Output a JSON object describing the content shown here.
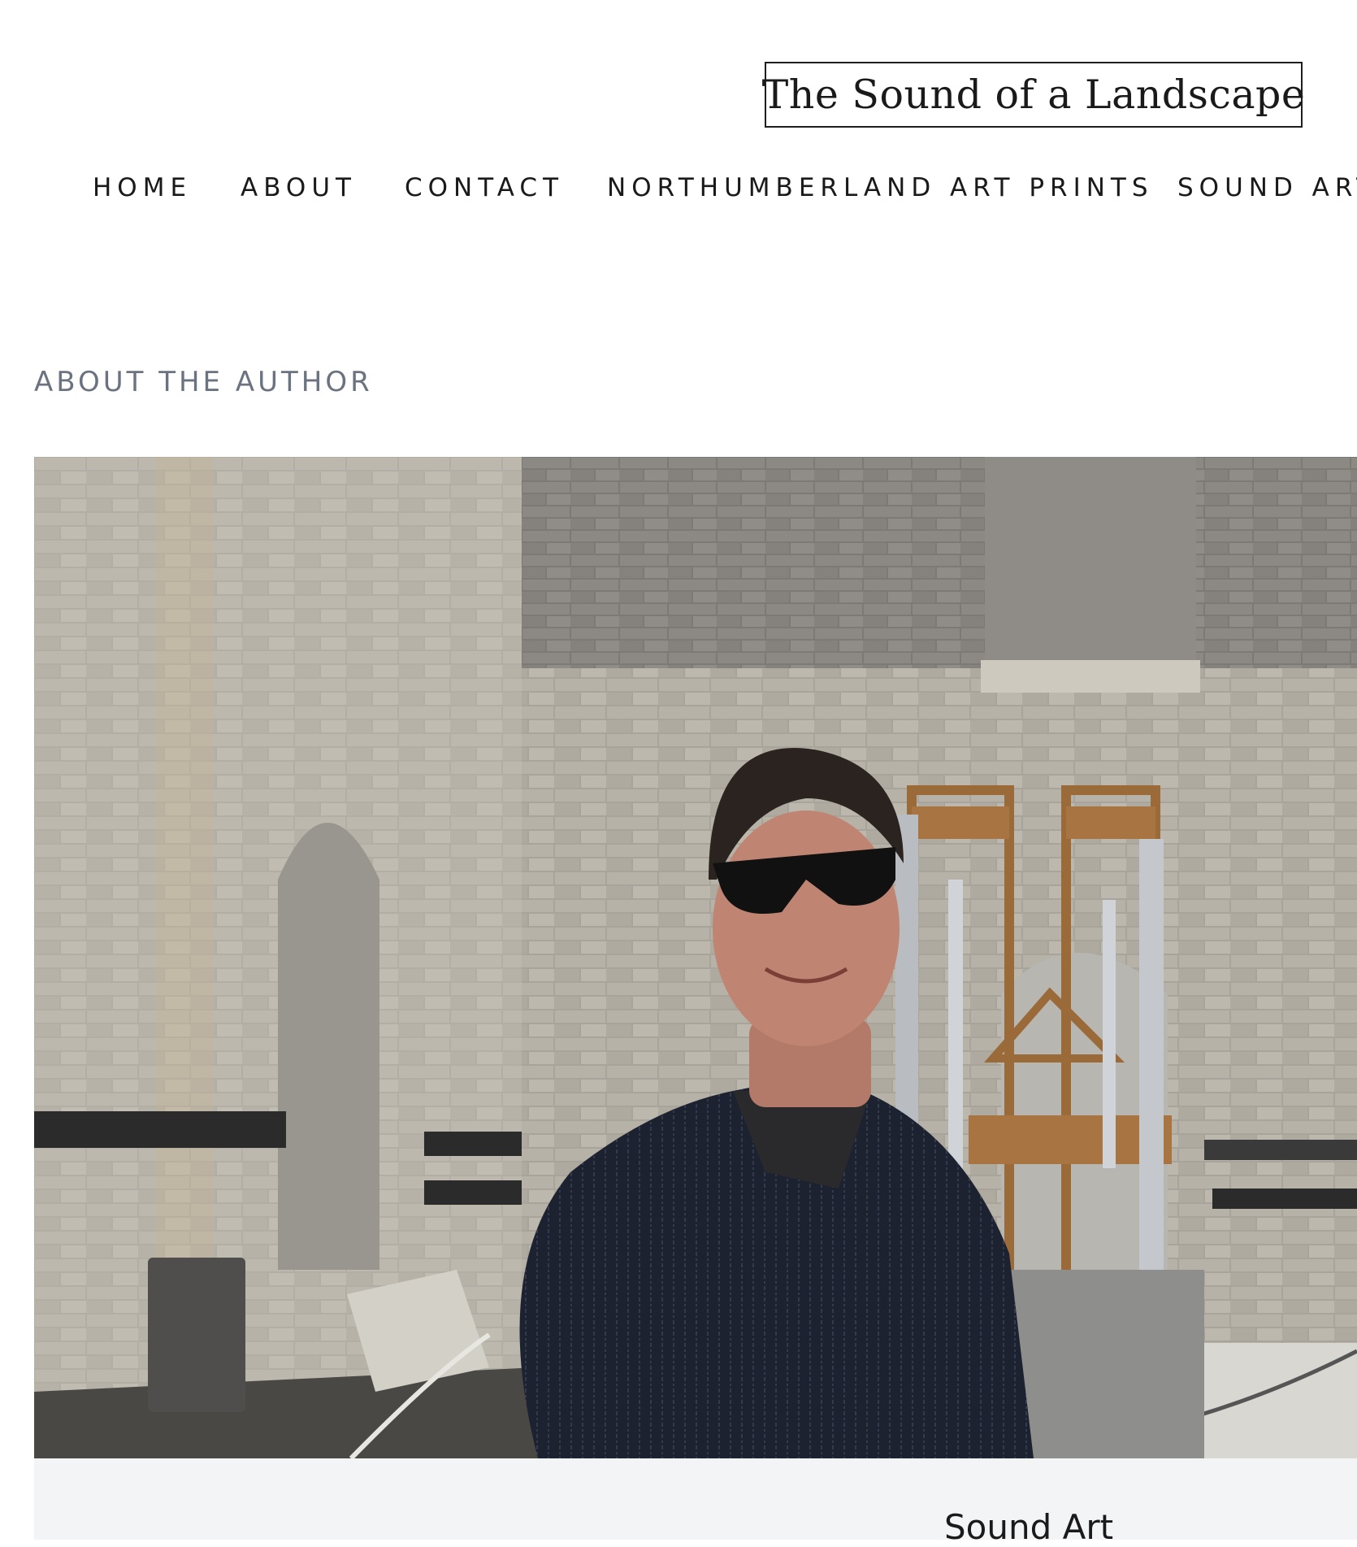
{
  "site": {
    "title": "The Sound of a Landscape"
  },
  "nav": {
    "items": [
      {
        "label": "HOME"
      },
      {
        "label": "ABOUT",
        "active": true
      },
      {
        "label": "CONTACT"
      },
      {
        "label": "NORTHUMBERLAND ART PRINTS"
      },
      {
        "label": "SOUND ART"
      }
    ]
  },
  "main": {
    "section_heading": "ABOUT THE AUTHOR",
    "photo": {
      "icon": "author-photo"
    },
    "card": {
      "title": "Sound Art"
    }
  },
  "colors": {
    "text": "#1a1a1a",
    "muted": "#6b7280",
    "card_background": "#f3f4f6",
    "page_background": "#ffffff"
  }
}
